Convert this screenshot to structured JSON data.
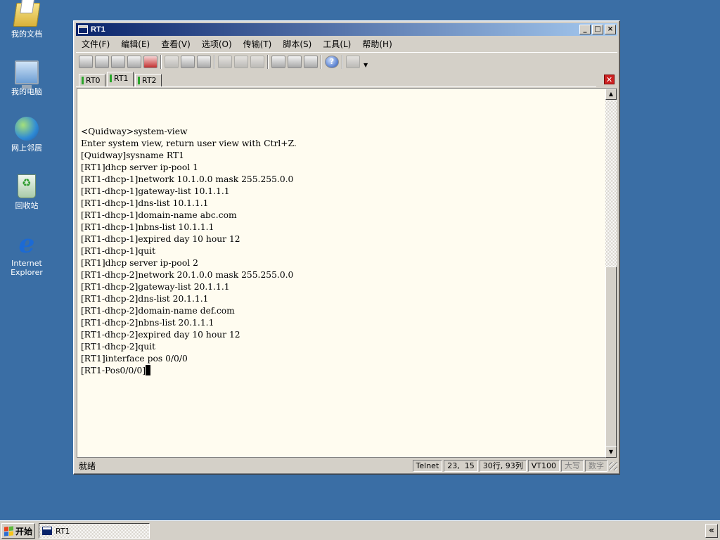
{
  "desktop": {
    "icons": [
      {
        "label": "我的文档",
        "icon": "folder-documents-icon"
      },
      {
        "label": "我的电脑",
        "icon": "computer-icon"
      },
      {
        "label": "网上邻居",
        "icon": "network-icon"
      },
      {
        "label": "回收站",
        "icon": "recycle-bin-icon"
      },
      {
        "label": "Internet Explorer",
        "icon": "internet-explorer-icon"
      }
    ]
  },
  "window": {
    "title": "RT1",
    "menu": [
      "文件(F)",
      "编辑(E)",
      "查看(V)",
      "选项(O)",
      "传输(T)",
      "脚本(S)",
      "工具(L)",
      "帮助(H)"
    ],
    "tabs": [
      "RT0",
      "RT1",
      "RT2"
    ],
    "active_tab": "RT1",
    "terminal": {
      "lines": [
        "",
        "<Quidway>system-view",
        "Enter system view, return user view with Ctrl+Z.",
        "[Quidway]sysname RT1",
        "[RT1]dhcp server ip-pool 1",
        "[RT1-dhcp-1]network 10.1.0.0 mask 255.255.0.0",
        "[RT1-dhcp-1]gateway-list 10.1.1.1",
        "[RT1-dhcp-1]dns-list 10.1.1.1",
        "[RT1-dhcp-1]domain-name abc.com",
        "[RT1-dhcp-1]nbns-list 10.1.1.1",
        "[RT1-dhcp-1]expired day 10 hour 12",
        "[RT1-dhcp-1]quit",
        "[RT1]dhcp server ip-pool 2",
        "[RT1-dhcp-2]network 20.1.0.0 mask 255.255.0.0",
        "[RT1-dhcp-2]gateway-list 20.1.1.1",
        "[RT1-dhcp-2]dns-list 20.1.1.1",
        "[RT1-dhcp-2]domain-name def.com",
        "[RT1-dhcp-2]nbns-list 20.1.1.1",
        "[RT1-dhcp-2]expired day 10 hour 12",
        "[RT1-dhcp-2]quit",
        "[RT1]interface pos 0/0/0"
      ],
      "prompt": "[RT1-Pos0/0/0]"
    },
    "status": {
      "ready": "就绪",
      "protocol": "Telnet",
      "cursor_pos": "23,  15",
      "size": "30行, 93列",
      "emulation": "VT100",
      "caps": "大写",
      "num": "数字"
    }
  },
  "taskbar": {
    "start_label": "开始",
    "task": "RT1",
    "tray_label": "«"
  }
}
